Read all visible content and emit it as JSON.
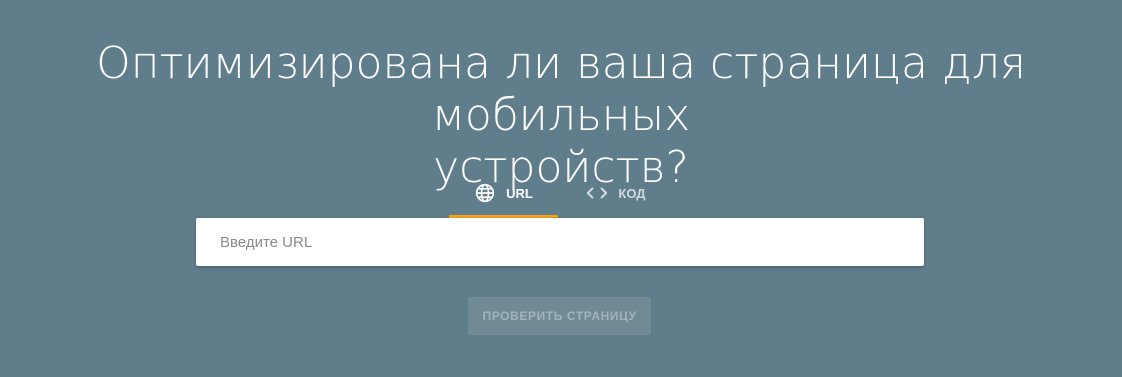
{
  "headline": {
    "line1": "Оптимизирована ли ваша страница для мобильных",
    "line2": "устройств?"
  },
  "tabs": [
    {
      "label": "URL",
      "icon": "globe-icon",
      "active": true
    },
    {
      "label": "КОД",
      "icon": "code-icon",
      "active": false
    }
  ],
  "search": {
    "placeholder": "Введите URL",
    "value": ""
  },
  "actions": {
    "check_label": "ПРОВЕРИТЬ СТРАНИЦУ"
  },
  "colors": {
    "background": "#607d8b",
    "tab_indicator": "#f4a21c",
    "input_background": "#ffffff"
  }
}
